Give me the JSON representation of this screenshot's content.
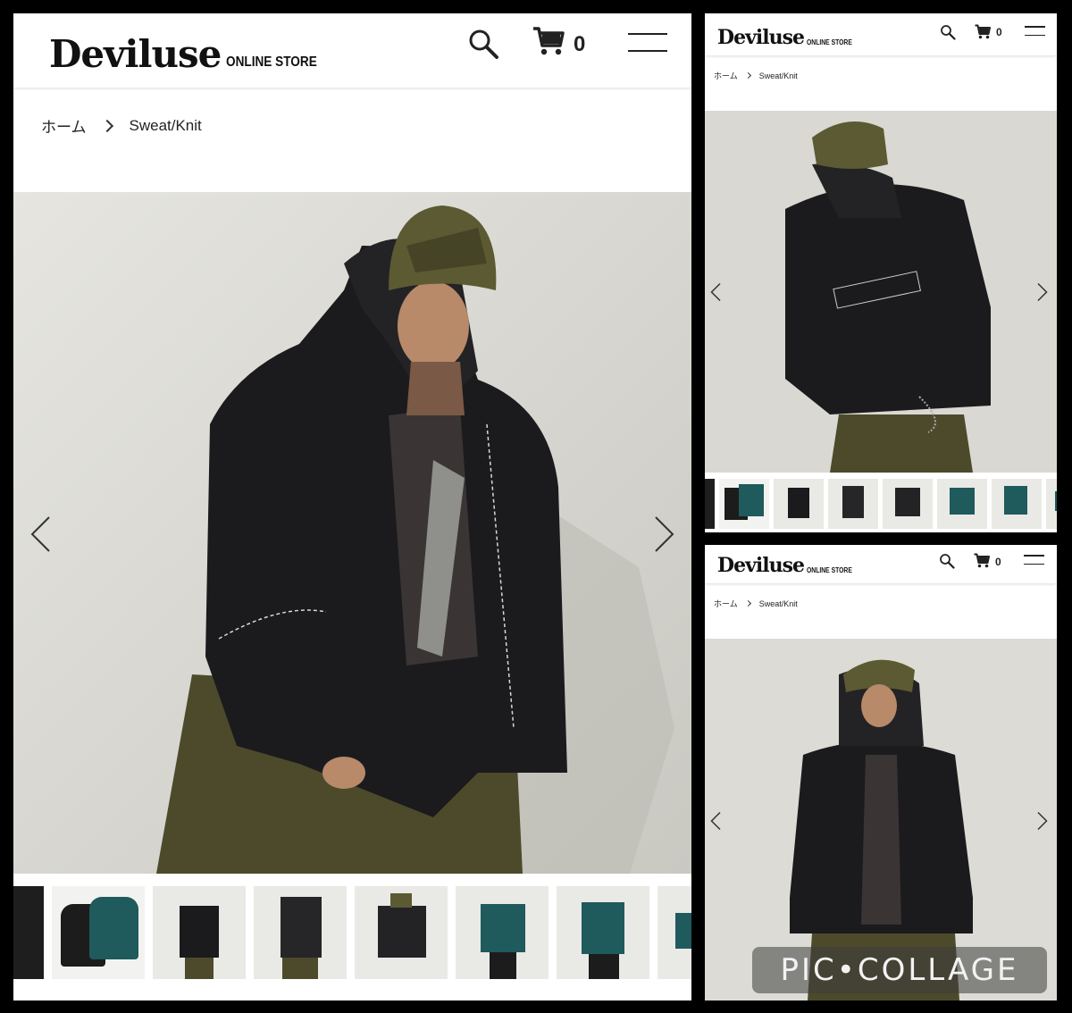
{
  "store": {
    "brand": "Deviluse",
    "subtitle": "ONLINE STORE",
    "cart_count": "0"
  },
  "breadcrumb": {
    "home": "ホーム",
    "current": "Sweat/Knit"
  },
  "icons": {
    "search": "search-icon",
    "cart": "cart-icon",
    "menu": "hamburger-menu-icon",
    "prev": "chevron-left-icon",
    "next": "chevron-right-icon"
  },
  "gallery": {
    "main_thumbnail_count": 8,
    "side_thumbnail_count": 8
  },
  "watermark": "PIC•COLLAGE",
  "colors": {
    "background": "#000000",
    "jacket": "#1b1b1d",
    "pants": "#4d4a2c",
    "wall": "#dddcd6",
    "teal": "#1f5a5c"
  }
}
